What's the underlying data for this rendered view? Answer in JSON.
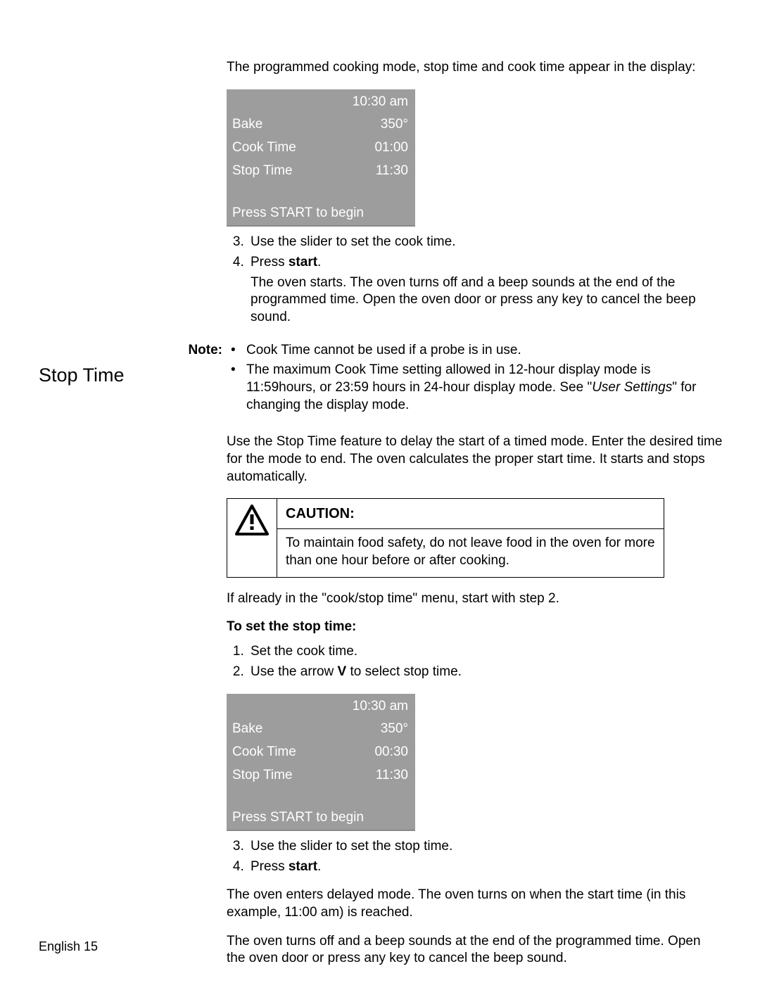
{
  "intro_line": "The programmed cooking mode, stop time and cook time appear in the display:",
  "display1": {
    "clock": "10:30 am",
    "mode_label": "Bake",
    "mode_value": "350°",
    "cook_label": "Cook Time",
    "cook_value": "01:00",
    "stop_label": "Stop Time",
    "stop_value": "11:30",
    "footer": "Press START to begin"
  },
  "steps_a": {
    "s3": "Use the slider to set the cook time.",
    "s4_prefix": "Press ",
    "s4_bold": "start",
    "s4_suffix": ".",
    "s4_body": "The oven starts. The oven turns off and a beep sounds at the end of the programmed time. Open the oven door or press any key to cancel the beep sound."
  },
  "note": {
    "label": "Note:",
    "b1": "Cook Time cannot be used if a probe is in use.",
    "b2_a": "The maximum Cook Time setting allowed in 12-hour display mode is 11:59hours, or 23:59 hours in 24-hour display mode. See \"",
    "b2_italic": "User Settings",
    "b2_b": "\" for changing the display mode."
  },
  "section_heading": "Stop Time",
  "stop_intro": "Use the Stop Time feature to delay the start of a timed mode. Enter the desired time for the mode to end. The oven calculates the proper start time. It starts and stops automatically.",
  "caution": {
    "title": "CAUTION:",
    "body": "To maintain food safety, do not leave food in the oven for more than one hour before or after cooking."
  },
  "already_in": "If already in the \"cook/stop time\" menu, start with step 2.",
  "set_stop_heading": "To set the stop time:",
  "steps_b": {
    "s1": "Set the cook time.",
    "s2_a": "Use the arrow ",
    "s2_bold": "V",
    "s2_b": " to select stop time."
  },
  "display2": {
    "clock": "10:30 am",
    "mode_label": "Bake",
    "mode_value": "350°",
    "cook_label": "Cook Time",
    "cook_value": "00:30",
    "stop_label": "Stop Time",
    "stop_value": "11:30",
    "footer": "Press START to begin"
  },
  "steps_c": {
    "s3": "Use the slider to set the stop time.",
    "s4_prefix": "Press ",
    "s4_bold": "start",
    "s4_suffix": "."
  },
  "tail1": "The oven enters delayed mode. The oven turns on when the start time (in this example, 11:00 am) is reached.",
  "tail2": "The oven turns off and a beep sounds at the end of the programmed time. Open the oven door or press any key to cancel the beep sound.",
  "page_footer": "English 15"
}
